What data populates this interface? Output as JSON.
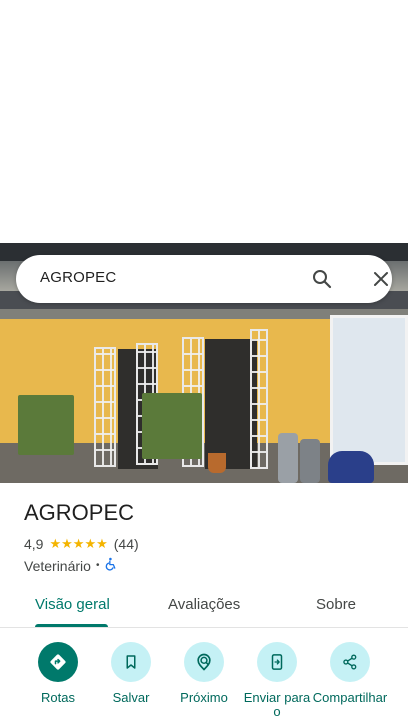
{
  "search": {
    "query": "AGROPEC"
  },
  "place": {
    "name": "AGROPEC",
    "rating": "4,9",
    "review_count": "(44)",
    "stars": 5,
    "category": "Veterinário",
    "separator": "•"
  },
  "tabs": [
    {
      "label": "Visão geral",
      "active": true
    },
    {
      "label": "Avaliações",
      "active": false
    },
    {
      "label": "Sobre",
      "active": false
    }
  ],
  "actions": [
    {
      "label": "Rotas",
      "icon": "directions-icon"
    },
    {
      "label": "Salvar",
      "icon": "bookmark-icon"
    },
    {
      "label": "Próximo",
      "icon": "nearby-icon"
    },
    {
      "label": "Enviar para o",
      "icon": "send-to-phone-icon"
    },
    {
      "label": "Compartilhar",
      "icon": "share-icon"
    }
  ],
  "colors": {
    "accent": "#00796b",
    "action_bg": "#c5f1f5",
    "star": "#f4b400"
  }
}
